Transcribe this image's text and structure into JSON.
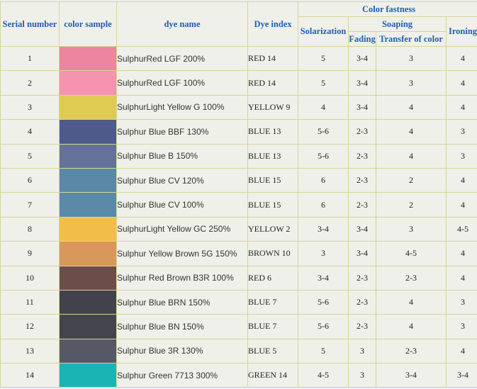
{
  "headers": {
    "serial": "Serial number",
    "sample": "color sample",
    "name": "dye name",
    "index": "Dye index",
    "fastness": "Color fastness",
    "solarization": "Solarization",
    "soaping": "Soaping",
    "fading": "Fading",
    "transfer": "Transfer of color",
    "ironing": "Ironing"
  },
  "rows": [
    {
      "serial": "1",
      "color": "#ee85a0",
      "name": "SulphurRed LGF 200%",
      "index": "RED 14",
      "solarization": "5",
      "fading": "3-4",
      "transfer": "3",
      "ironing": "4"
    },
    {
      "serial": "2",
      "color": "#f593b0",
      "name": "SulphurRed LGF 100%",
      "index": "RED 14",
      "solarization": "5",
      "fading": "3-4",
      "transfer": "3",
      "ironing": "4"
    },
    {
      "serial": "3",
      "color": "#dfcb52",
      "name": "SulphurLight Yellow G 100%",
      "index": "YELLOW 9",
      "solarization": "4",
      "fading": "3-4",
      "transfer": "4",
      "ironing": "4"
    },
    {
      "serial": "4",
      "color": "#4e5a8c",
      "name": "Sulphur Blue BBF 130%",
      "index": "BLUE 13",
      "solarization": "5-6",
      "fading": "2-3",
      "transfer": "4",
      "ironing": "3"
    },
    {
      "serial": "5",
      "color": "#64729a",
      "name": "Sulphur Blue B 150%",
      "index": "BLUE 13",
      "solarization": "5-6",
      "fading": "2-3",
      "transfer": "4",
      "ironing": "3"
    },
    {
      "serial": "6",
      "color": "#5a88a6",
      "name": "Sulphur Blue CV 120%",
      "index": "BLUE 15",
      "solarization": "6",
      "fading": "2-3",
      "transfer": "2",
      "ironing": "4"
    },
    {
      "serial": "7",
      "color": "#5a8aa8",
      "name": "Sulphur Blue CV 100%",
      "index": "BLUE 15",
      "solarization": "6",
      "fading": "2-3",
      "transfer": "2",
      "ironing": "4"
    },
    {
      "serial": "8",
      "color": "#f2be48",
      "name": "SulphurLight Yellow GC 250%",
      "index": "YELLOW 2",
      "solarization": "3-4",
      "fading": "3-4",
      "transfer": "3",
      "ironing": "4-5"
    },
    {
      "serial": "9",
      "color": "#d8985a",
      "name": "Sulphur Yellow Brown 5G 150%",
      "index": "BROWN 10",
      "solarization": "3",
      "fading": "3-4",
      "transfer": "4-5",
      "ironing": "4"
    },
    {
      "serial": "10",
      "color": "#6d4d4a",
      "name": "Sulphur Red Brown B3R 100%",
      "index": "RED 6",
      "solarization": "3-4",
      "fading": "2-3",
      "transfer": "2-3",
      "ironing": "4"
    },
    {
      "serial": "11",
      "color": "#42424f",
      "name": "Sulphur Blue BRN 150%",
      "index": "BLUE 7",
      "solarization": "5-6",
      "fading": "2-3",
      "transfer": "4",
      "ironing": "3"
    },
    {
      "serial": "12",
      "color": "#44444f",
      "name": "Sulphur Blue BN 150%",
      "index": "BLUE 7",
      "solarization": "5-6",
      "fading": "2-3",
      "transfer": "4",
      "ironing": "3"
    },
    {
      "serial": "13",
      "color": "#565868",
      "name": "Sulphur Blue 3R 130%",
      "index": "BLUE 5",
      "solarization": "5",
      "fading": "3",
      "transfer": "2-3",
      "ironing": "4"
    },
    {
      "serial": "14",
      "color": "#1bb4b5",
      "name": "Sulphur Green 7713 300%",
      "index": "GREEN 14",
      "solarization": "4-5",
      "fading": "3",
      "transfer": "3-4",
      "ironing": "3-4"
    }
  ]
}
